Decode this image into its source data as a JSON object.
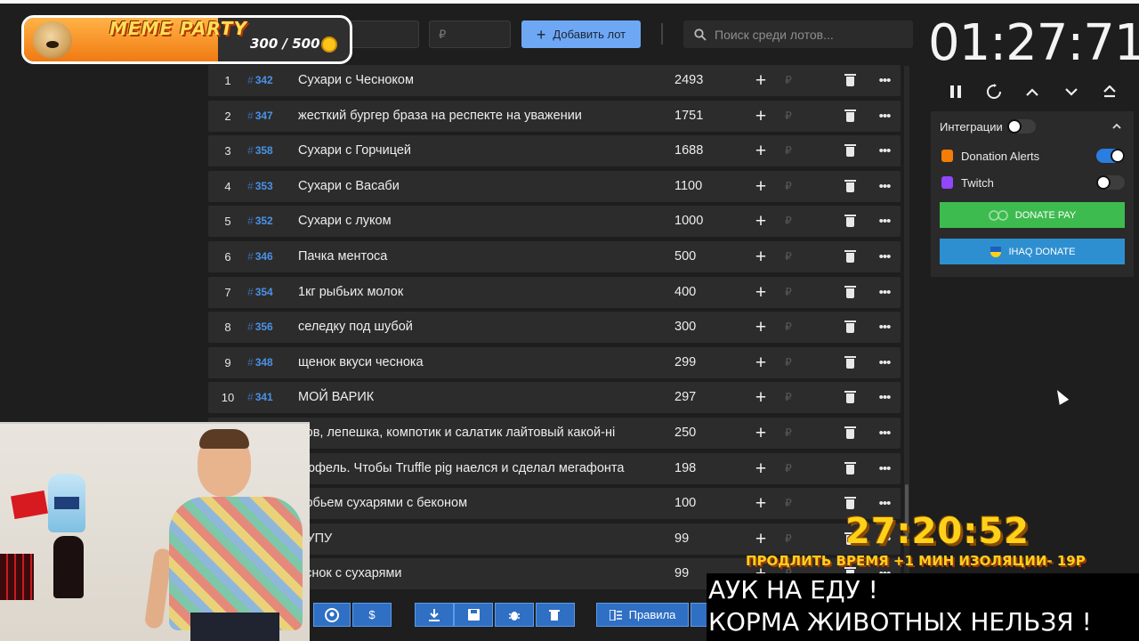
{
  "overlay": {
    "title": "MEME PARTY",
    "count": "300 / 500"
  },
  "controls": {
    "field1_placeholder": "",
    "currency_placeholder": "₽",
    "add_label": "Добавить лот",
    "search_placeholder": "Поиск среди лотов..."
  },
  "lots": [
    {
      "idx": "1",
      "id": "342",
      "name": "Сухари с Чесноком",
      "amount": "2493"
    },
    {
      "idx": "2",
      "id": "347",
      "name": "жесткий бургер браза на респекте на уважении",
      "amount": "1751"
    },
    {
      "idx": "3",
      "id": "358",
      "name": "Сухари с Горчицей",
      "amount": "1688"
    },
    {
      "idx": "4",
      "id": "353",
      "name": "Сухари с Васаби",
      "amount": "1100"
    },
    {
      "idx": "5",
      "id": "352",
      "name": "Сухари с луком",
      "amount": "1000"
    },
    {
      "idx": "6",
      "id": "346",
      "name": "Пачка ментоса",
      "amount": "500"
    },
    {
      "idx": "7",
      "id": "354",
      "name": "1кг рыбьих молок",
      "amount": "400"
    },
    {
      "idx": "8",
      "id": "356",
      "name": " селедку под шубой",
      "amount": "300"
    },
    {
      "idx": "9",
      "id": "348",
      "name": "щенок вкуси чеснока",
      "amount": "299"
    },
    {
      "idx": "10",
      "id": "341",
      "name": "МОЙ ВАРИК",
      "amount": "297"
    },
    {
      "idx": "",
      "id": "",
      "name": "лов, лепешка, компотик и салатик лайтовый какой-ні",
      "amount": "250"
    },
    {
      "idx": "",
      "id": "",
      "name": "рюфель. Чтобы Truffle pig наелся и сделал мегафонта",
      "amount": "198"
    },
    {
      "idx": "",
      "id": "",
      "name": "добьем сухарями с беконом",
      "amount": "100"
    },
    {
      "idx": "",
      "id": "",
      "name": "РУПУ",
      "amount": "99"
    },
    {
      "idx": "",
      "id": "",
      "name": "еснок с сухарями",
      "amount": "99"
    }
  ],
  "row_symbols": {
    "plus": "+",
    "rub": "₽",
    "more": "•••"
  },
  "toolbar": {
    "rules_label": "Правила",
    "dollar": "$"
  },
  "timer": "01:27:71",
  "panel": {
    "integrations_label": "Интеграции",
    "donation_alerts_label": "Donation Alerts",
    "twitch_label": "Twitch",
    "donate_pay_label": "DONATE PAY",
    "ihaq_label": "IHAQ DONATE"
  },
  "stream_overlay": {
    "countdown": "27:20:52",
    "extend_text": "ПРОДЛИТЬ ВРЕМЯ +1 МИН ИЗОЛЯЦИИ- 19Р",
    "line1": "АУК НА ЕДУ !",
    "line2": "КОРМА ЖИВОТНЫХ НЕЛЬЗЯ !"
  },
  "colors": {
    "accent_blue": "#6ea8f5",
    "donate_pay_green": "#3dbb4f",
    "ihaq_blue": "#2e8fd0",
    "toggle_on": "#2a7de1"
  }
}
